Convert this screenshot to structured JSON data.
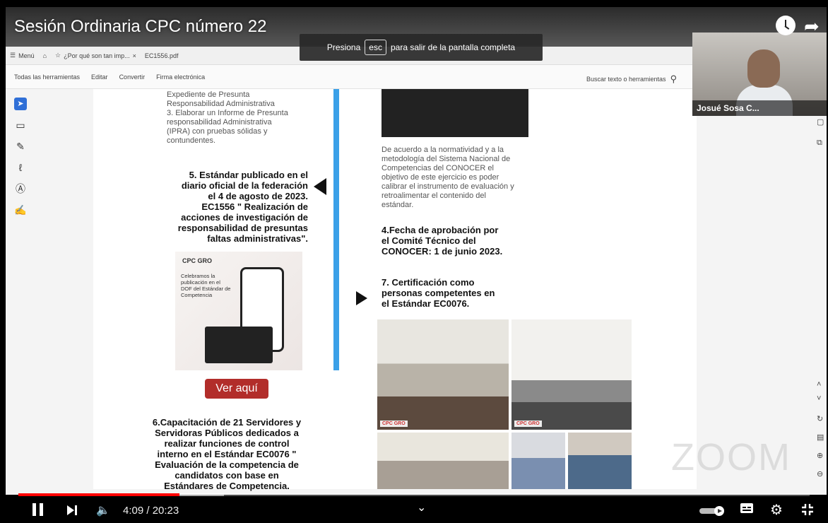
{
  "video": {
    "title": "Sesión Ordinaria CPC número 22",
    "time": "4:09 / 20:23",
    "progress_fraction": 0.204,
    "buffered_fraction": 0.26
  },
  "banner": {
    "prefix": "Presiona",
    "key": "esc",
    "suffix": "para salir de la pantalla completa"
  },
  "acrobat": {
    "tabs": {
      "menu": "Menú",
      "tab1": "¿Por qué son tan imp...",
      "tab1_close": "×",
      "tab2": "EC1556.pdf"
    },
    "toolbar": {
      "all_tools": "Todas las herramientas",
      "edit": "Editar",
      "convert": "Convertir",
      "esign": "Firma electrónica",
      "search": "Buscar texto o herramientas"
    }
  },
  "doc": {
    "left_list": "Expediente de Presunta\nResponsabilidad Administrativa\n3. Elaborar un Informe de Presunta\nresponsabilidad Administrativa\n(IPRA) con pruebas sólidas y\ncontundentes.",
    "item5": "5.  Estándar publicado en el\ndiario oficial de la federación\nel 4 de agosto de 2023.\nEC1556 \" Realización de\nacciones de investigación de\nresponsabilidad de presuntas\nfaltas administrativas\".",
    "poster": {
      "logo": "CPC GRO",
      "text": "Celebramos la publicación en el DOF del Estándar de Competencia"
    },
    "ver_aqui": "Ver aquí",
    "item6": "6.Capacitación de 21 Servidores y\nServidoras Públicos dedicados a\nrealizar funciones de control\ninterno en el Estándar EC0076 \"\nEvaluación de la competencia de\ncandidatos con base en\nEstándares de Competencia.",
    "right_para": "De acuerdo a la normatividad y a la\nmetodología del Sistema Nacional de\nCompetencias del CONOCER el\nobjetivo de este ejercicio es poder\ncalibrar el instrumento de evaluación y\nretroalimentar el contenido del\nestándar.",
    "item4": "4.Fecha de aprobación por\nel Comité Técnico del\nCONOCER: 1 de junio 2023.",
    "item7": "7. Certificación como\npersonas competentes en\nel Estándar EC0076.",
    "photo_badge": "CPC GRO"
  },
  "cam": {
    "name": "Josué Sosa C..."
  },
  "watermark": "ZOOM",
  "icons": {
    "clock": "watch-later-icon",
    "share": "share-icon",
    "pause": "pause-icon",
    "next": "next-icon",
    "volume": "volume-icon",
    "chevron": "chevron-down-icon",
    "autoplay": "autoplay-toggle-icon",
    "subtitles": "subtitles-icon",
    "settings": "settings-gear-icon",
    "exit_fullscreen": "exit-fullscreen-icon"
  }
}
